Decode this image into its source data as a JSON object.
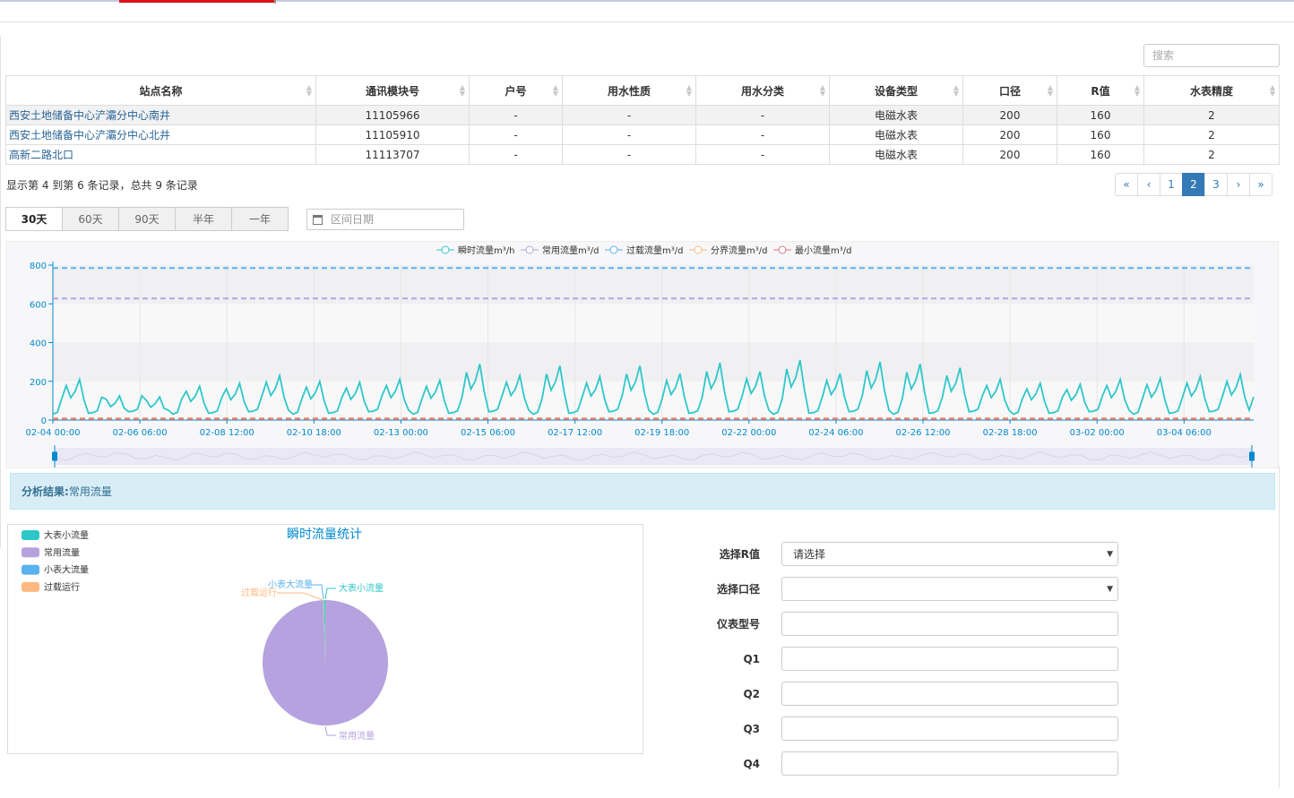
{
  "search": {
    "placeholder": "搜索"
  },
  "table": {
    "headers": [
      "站点名称",
      "通讯模块号",
      "户号",
      "用水性质",
      "用水分类",
      "设备类型",
      "口径",
      "R值",
      "水表精度"
    ],
    "rows": [
      [
        "西安土地储备中心浐灞分中心南井",
        "11105966",
        "-",
        "-",
        "-",
        "电磁水表",
        "200",
        "160",
        "2"
      ],
      [
        "西安土地储备中心浐灞分中心北井",
        "11105910",
        "-",
        "-",
        "-",
        "电磁水表",
        "200",
        "160",
        "2"
      ],
      [
        "高新二路北口",
        "11113707",
        "-",
        "-",
        "-",
        "电磁水表",
        "200",
        "160",
        "2"
      ]
    ]
  },
  "records_info": "显示第 4 到第 6 条记录，总共 9 条记录",
  "pagination": {
    "items": [
      "«",
      "‹",
      "1",
      "2",
      "3",
      "›",
      "»"
    ],
    "active_page": "2"
  },
  "range_buttons": {
    "items": [
      "30天",
      "60天",
      "90天",
      "半年",
      "一年"
    ],
    "active": "30天"
  },
  "date_input": {
    "placeholder": "区间日期",
    "icon": "calendar-icon"
  },
  "chart_data": {
    "type": "line",
    "legend": [
      "瞬时流量m³/h",
      "常用流量m³/d",
      "过载流量m³/d",
      "分界流量m³/d",
      "最小流量m³/d"
    ],
    "legend_colors": [
      "#2ec7c9",
      "#b6a2de",
      "#5ab1ef",
      "#ffb980",
      "#d87a80"
    ],
    "legend_position": "top-center",
    "y_ticks": [
      "0",
      "200",
      "400",
      "600",
      "800"
    ],
    "ylim": [
      0,
      800
    ],
    "x_ticks": [
      "02-04 00:00",
      "02-06 06:00",
      "02-08 12:00",
      "02-10 18:00",
      "02-13 00:00",
      "02-15 06:00",
      "02-17 12:00",
      "02-19 18:00",
      "02-22 00:00",
      "02-24 06:00",
      "02-26 12:00",
      "02-28 18:00",
      "03-02 00:00",
      "03-04 06:00"
    ],
    "x_start": "02-04 00:00",
    "x_end": "03-06 00:00",
    "reference_lines": [
      {
        "name": "过载流量m³/d",
        "value": 785
      },
      {
        "name": "常用流量m³/d",
        "value": 628
      },
      {
        "name": "分界流量m³/d",
        "value": 10
      },
      {
        "name": "最小流量m³/d",
        "value": 5
      }
    ],
    "daily_peaks_m3h": [
      210,
      125,
      120,
      175,
      190,
      230,
      200,
      195,
      210,
      205,
      290,
      230,
      280,
      225,
      280,
      240,
      295,
      250,
      310,
      240,
      300,
      290,
      270,
      210,
      190,
      185,
      210,
      215,
      225,
      235
    ],
    "dataZoom": true
  },
  "analysis": {
    "label": "分析结果:",
    "value": "常用流量"
  },
  "pie": {
    "title": "瞬时流量统计",
    "legend": [
      {
        "name": "大表小流量",
        "color": "#2ec7c9"
      },
      {
        "name": "常用流量",
        "color": "#b6a2de"
      },
      {
        "name": "小表大流量",
        "color": "#5ab1ef"
      },
      {
        "name": "过载运行",
        "color": "#ffb980"
      }
    ],
    "chart_data": {
      "type": "pie",
      "title": "瞬时流量统计",
      "slices": [
        {
          "name": "大表小流量",
          "value": 0.4
        },
        {
          "name": "常用流量",
          "value": 99.2
        },
        {
          "name": "小表大流量",
          "value": 0.2
        },
        {
          "name": "过载运行",
          "value": 0.2
        }
      ]
    }
  },
  "form": {
    "r_value": {
      "label": "选择R值",
      "value": "请选择"
    },
    "caliber": {
      "label": "选择口径",
      "value": ""
    },
    "meter_model": {
      "label": "仪表型号",
      "value": ""
    },
    "q1": {
      "label": "Q1",
      "value": ""
    },
    "q2": {
      "label": "Q2",
      "value": ""
    },
    "q3": {
      "label": "Q3",
      "value": ""
    },
    "q4": {
      "label": "Q4",
      "value": ""
    }
  }
}
